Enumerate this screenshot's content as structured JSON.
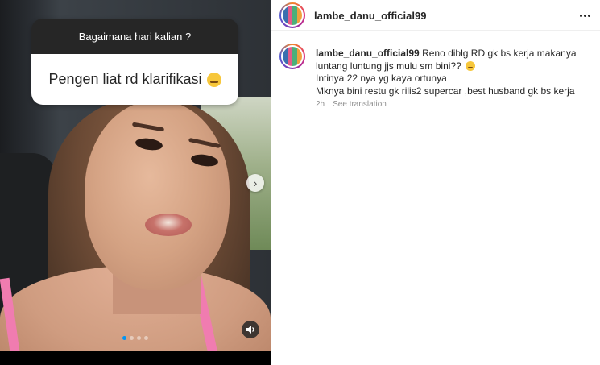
{
  "story": {
    "question_title": "Bagaimana hari kalian ?",
    "question_answer": "Pengen liat rd klarifikasi",
    "slide_count": 4,
    "active_slide": 1
  },
  "post": {
    "username": "lambe_danu_official99"
  },
  "comment": {
    "username": "lambe_danu_official99",
    "lines": [
      "Reno diblg RD gk bs kerja makanya luntang luntung jjs mulu sm bini??",
      "Intinya 22 nya yg kaya ortunya",
      "Mknya bini restu gk rilis2 supercar ,best husband gk bs kerja"
    ],
    "time": "2h",
    "translate_label": "See translation"
  },
  "icons": {
    "next": "chevron-right-icon",
    "sound": "speaker-icon",
    "more": "more-horizontal-icon"
  },
  "colors": {
    "accent": "#0095f6",
    "text": "#262626",
    "muted": "#8e8e8e"
  }
}
